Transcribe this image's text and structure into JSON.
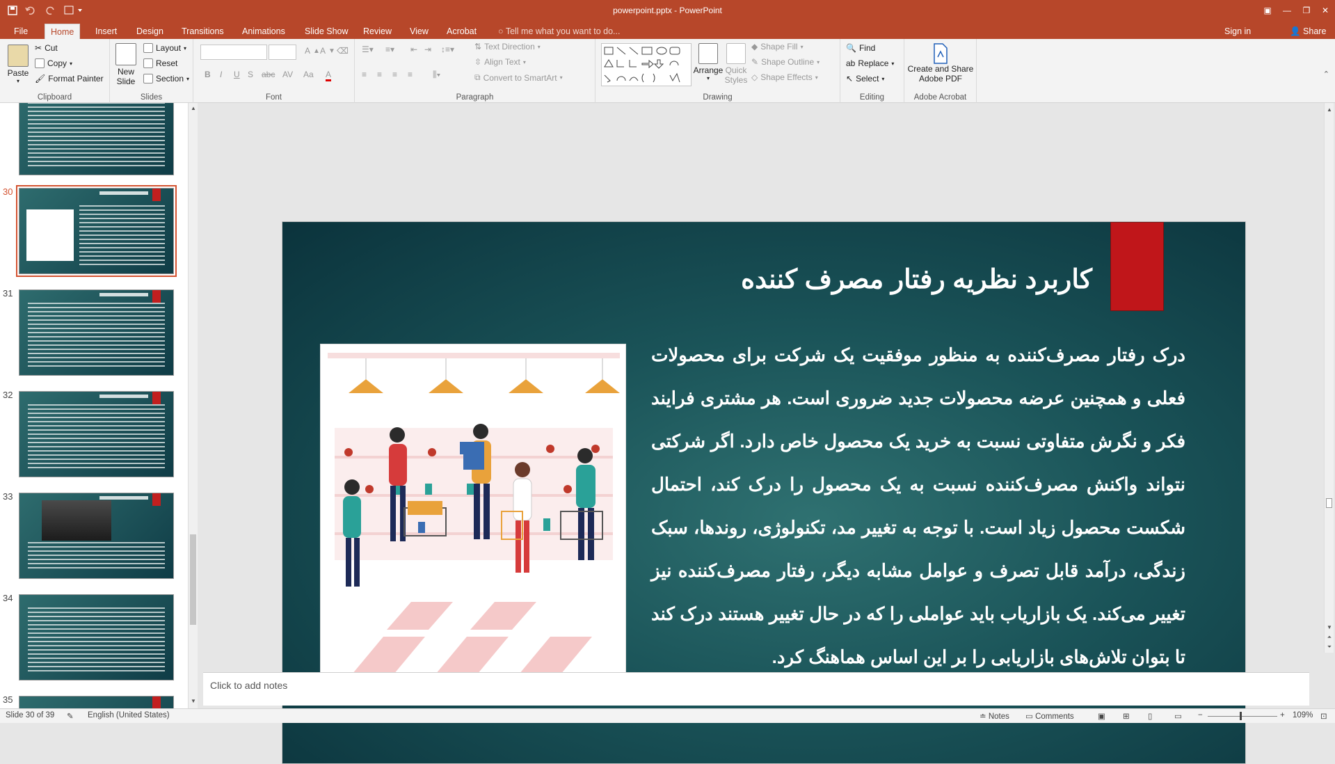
{
  "titlebar": {
    "doc_title": "powerpoint.pptx - PowerPoint",
    "qa_icons": [
      "save-icon",
      "undo-icon",
      "redo-icon",
      "customize-icon"
    ],
    "window_controls": [
      "ribbon-display-icon",
      "minimize-icon",
      "restore-icon",
      "close-icon"
    ]
  },
  "tabs": [
    {
      "label": "File"
    },
    {
      "label": "Home"
    },
    {
      "label": "Insert"
    },
    {
      "label": "Design"
    },
    {
      "label": "Transitions"
    },
    {
      "label": "Animations"
    },
    {
      "label": "Slide Show"
    },
    {
      "label": "Review"
    },
    {
      "label": "View"
    },
    {
      "label": "Acrobat"
    }
  ],
  "tell_me": "Tell me what you want to do...",
  "sign_in": "Sign in",
  "share": "Share",
  "ribbon": {
    "clipboard": {
      "label": "Clipboard",
      "paste": "Paste",
      "cut": "Cut",
      "copy": "Copy",
      "format_painter": "Format Painter"
    },
    "slides": {
      "label": "Slides",
      "new_slide_line1": "New",
      "new_slide_line2": "Slide",
      "layout": "Layout",
      "reset": "Reset",
      "section": "Section"
    },
    "font": {
      "label": "Font",
      "bold": "B",
      "italic": "I",
      "underline": "U",
      "strike": "S",
      "shadow": "abc",
      "spacing": "AV",
      "case": "Aa",
      "color": "A"
    },
    "paragraph": {
      "label": "Paragraph",
      "text_direction": "Text Direction",
      "align_text": "Align Text",
      "convert_smartart": "Convert to SmartArt"
    },
    "drawing": {
      "label": "Drawing",
      "arrange": "Arrange",
      "quick_styles_line1": "Quick",
      "quick_styles_line2": "Styles",
      "shape_fill": "Shape Fill",
      "shape_outline": "Shape Outline",
      "shape_effects": "Shape Effects"
    },
    "editing": {
      "label": "Editing",
      "find": "Find",
      "replace": "Replace",
      "select": "Select"
    },
    "acrobat": {
      "label": "Adobe Acrobat",
      "create_line1": "Create and Share",
      "create_line2": "Adobe PDF"
    }
  },
  "thumbnails": [
    {
      "number": "",
      "selected": false
    },
    {
      "number": "30",
      "selected": true
    },
    {
      "number": "31",
      "selected": false
    },
    {
      "number": "32",
      "selected": false
    },
    {
      "number": "33",
      "selected": false
    },
    {
      "number": "34",
      "selected": false
    },
    {
      "number": "35",
      "selected": false
    }
  ],
  "slide": {
    "title": "کاربرد نظریه رفتار مصرف کننده",
    "body": "درک رفتار مصرف‌کننده به منظور موفقیت یک شرکت برای محصولات فعلی و همچنین عرضه محصولات جدید ضروری است. هر مشتری فرایند فکر و نگرش متفاوتی نسبت به خرید یک محصول خاص دارد. اگر شرکتی نتواند واکنش مصرف‌کننده نسبت به یک محصول را درک کند، احتمال شکست محصول زیاد است. با توجه به تغییر مد، تکنولوژی، روندها، سبک زندگی، درآمد قابل تصرف و عوامل مشابه دیگر، رفتار مصرف‌کننده نیز تغییر می‌کند. یک بازاریاب باید عواملی را که در حال تغییر هستند درک کند تا بتوان تلاش‌های بازاریابی را بر این اساس هماهنگ کرد."
  },
  "notes_placeholder": "Click to add notes",
  "status": {
    "slide_info": "Slide 30 of 39",
    "language": "English (United States)",
    "notes": "Notes",
    "comments": "Comments",
    "zoom": "109%"
  },
  "colors": {
    "accent": "#b7472a",
    "bookmark": "#c0161a",
    "slide_bg": "#1a5358"
  }
}
